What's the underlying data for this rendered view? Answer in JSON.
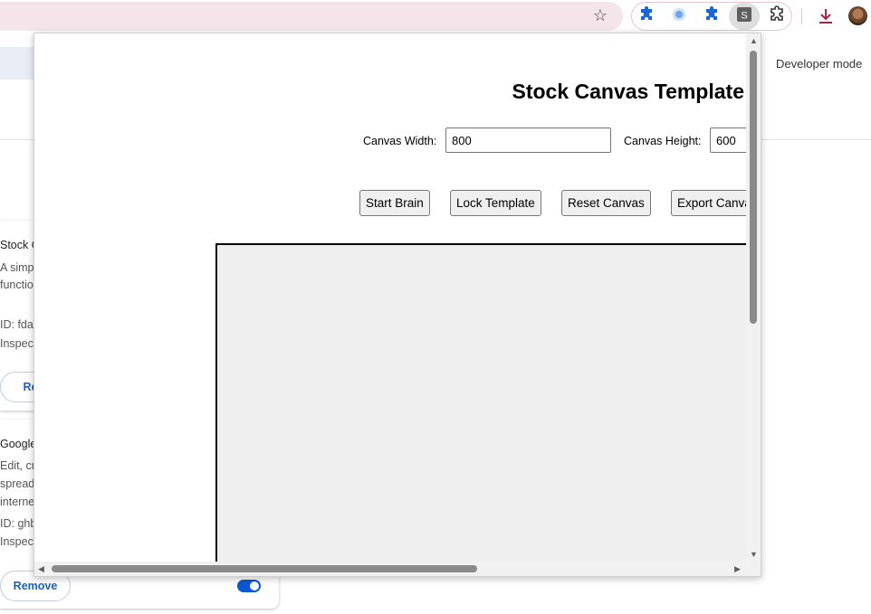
{
  "background_page": {
    "developer_mode_label": "Developer mode",
    "cards": [
      {
        "title": "Stock C",
        "description_lines": [
          "A simp",
          "functio"
        ],
        "id_line": "ID: fda",
        "inspect_line": "Inspec",
        "remove_label": "Rem"
      },
      {
        "title": "Google",
        "description_lines": [
          "Edit, cr",
          "spread",
          "interne"
        ],
        "id_line": "ID: ghb",
        "inspect_line": "Inspec",
        "remove_label": "Remove",
        "toggle_on": true
      }
    ]
  },
  "popup": {
    "title": "Stock Canvas Template",
    "canvas_width": {
      "label": "Canvas Width:",
      "value": "800"
    },
    "canvas_height": {
      "label": "Canvas Height:",
      "value": "600"
    },
    "buttons": {
      "start_brain": "Start Brain",
      "lock_template": "Lock Template",
      "reset_canvas": "Reset Canvas",
      "export_canvas": "Export Canvas"
    }
  },
  "toolbar": {
    "icons": [
      "star-icon",
      "puzzle-icon",
      "blue-dot-icon",
      "puzzle-icon",
      "s-extension-icon",
      "extensions-menu-icon",
      "download-icon",
      "avatar"
    ]
  },
  "colors": {
    "omnibox_bg": "#f4e5ea",
    "toggle_accent": "#0b57d0",
    "link_blue": "#1a5fc7"
  }
}
